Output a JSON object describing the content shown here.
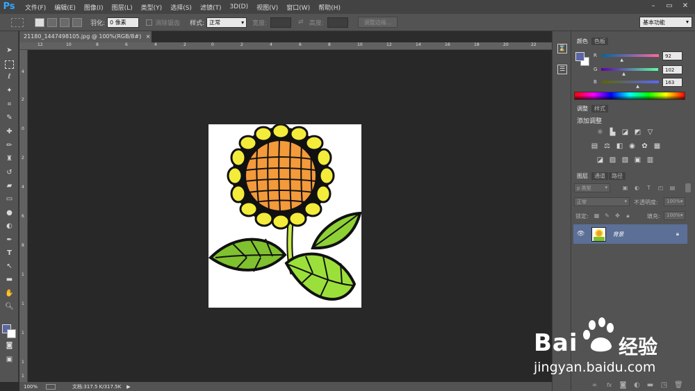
{
  "app": {
    "logo": "Ps"
  },
  "menu": [
    "文件(F)",
    "编辑(E)",
    "图像(I)",
    "图层(L)",
    "类型(Y)",
    "选择(S)",
    "滤镜(T)",
    "3D(D)",
    "视图(V)",
    "窗口(W)",
    "帮助(H)"
  ],
  "window_controls": [
    "–",
    "▭",
    "✕"
  ],
  "options": {
    "feather_label": "羽化:",
    "feather_value": "0 像素",
    "antialias_label": "消除锯齿",
    "style_label": "样式:",
    "style_value": "正常",
    "width_label": "宽度:",
    "height_label": "高度:",
    "refine_button": "调整边缘...",
    "workspace": "基本功能"
  },
  "document": {
    "tab_title": "21180_1447498105.jpg @ 100%(RGB/8#)",
    "close": "×"
  },
  "rulers": {
    "top": [
      "12",
      "10",
      "8",
      "6",
      "4",
      "2",
      "0",
      "2",
      "4",
      "6",
      "8",
      "10",
      "12",
      "14",
      "16",
      "18",
      "20",
      "22"
    ],
    "left": [
      "4",
      "2",
      "0",
      "2",
      "4",
      "6",
      "8",
      "1",
      "1",
      "1",
      "1",
      "1"
    ]
  },
  "status": {
    "zoom": "100%",
    "doc_info": "文档:317.5 K/317.5K",
    "arrow": "▶"
  },
  "color_panel": {
    "tabs": [
      "颜色",
      "色板"
    ],
    "channels": [
      {
        "label": "R",
        "value": "92",
        "fraction": 0.36
      },
      {
        "label": "G",
        "value": "102",
        "fraction": 0.4
      },
      {
        "label": "B",
        "value": "163",
        "fraction": 0.64
      }
    ],
    "foreground_color": "#5c66a3"
  },
  "adjustments_panel": {
    "tabs": [
      "调整",
      "样式"
    ],
    "title": "添加调整"
  },
  "layers_panel": {
    "tabs": [
      "图层",
      "通道",
      "路径"
    ],
    "kind_filter": "ρ 类型",
    "blend_mode": "正常",
    "opacity_label": "不透明度:",
    "opacity_value": "100%",
    "lock_label": "锁定:",
    "fill_label": "填充:",
    "fill_value": "100%",
    "layer_name": "背景"
  },
  "watermark": {
    "brand": "Bai",
    "brand2": "经验",
    "url": "jingyan.baidu.com"
  }
}
